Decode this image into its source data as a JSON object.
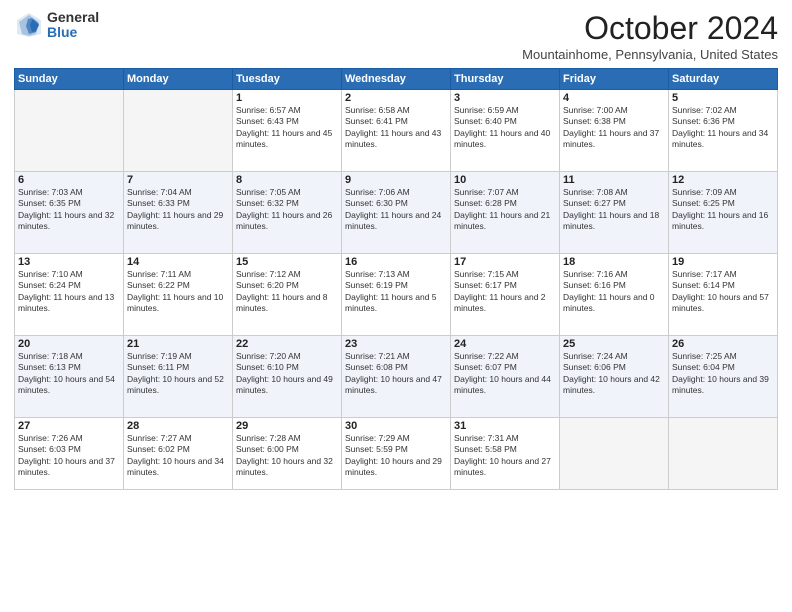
{
  "logo": {
    "general": "General",
    "blue": "Blue"
  },
  "header": {
    "month": "October 2024",
    "location": "Mountainhome, Pennsylvania, United States"
  },
  "days_of_week": [
    "Sunday",
    "Monday",
    "Tuesday",
    "Wednesday",
    "Thursday",
    "Friday",
    "Saturday"
  ],
  "weeks": [
    [
      {
        "day": "",
        "info": ""
      },
      {
        "day": "",
        "info": ""
      },
      {
        "day": "1",
        "info": "Sunrise: 6:57 AM\nSunset: 6:43 PM\nDaylight: 11 hours and 45 minutes."
      },
      {
        "day": "2",
        "info": "Sunrise: 6:58 AM\nSunset: 6:41 PM\nDaylight: 11 hours and 43 minutes."
      },
      {
        "day": "3",
        "info": "Sunrise: 6:59 AM\nSunset: 6:40 PM\nDaylight: 11 hours and 40 minutes."
      },
      {
        "day": "4",
        "info": "Sunrise: 7:00 AM\nSunset: 6:38 PM\nDaylight: 11 hours and 37 minutes."
      },
      {
        "day": "5",
        "info": "Sunrise: 7:02 AM\nSunset: 6:36 PM\nDaylight: 11 hours and 34 minutes."
      }
    ],
    [
      {
        "day": "6",
        "info": "Sunrise: 7:03 AM\nSunset: 6:35 PM\nDaylight: 11 hours and 32 minutes."
      },
      {
        "day": "7",
        "info": "Sunrise: 7:04 AM\nSunset: 6:33 PM\nDaylight: 11 hours and 29 minutes."
      },
      {
        "day": "8",
        "info": "Sunrise: 7:05 AM\nSunset: 6:32 PM\nDaylight: 11 hours and 26 minutes."
      },
      {
        "day": "9",
        "info": "Sunrise: 7:06 AM\nSunset: 6:30 PM\nDaylight: 11 hours and 24 minutes."
      },
      {
        "day": "10",
        "info": "Sunrise: 7:07 AM\nSunset: 6:28 PM\nDaylight: 11 hours and 21 minutes."
      },
      {
        "day": "11",
        "info": "Sunrise: 7:08 AM\nSunset: 6:27 PM\nDaylight: 11 hours and 18 minutes."
      },
      {
        "day": "12",
        "info": "Sunrise: 7:09 AM\nSunset: 6:25 PM\nDaylight: 11 hours and 16 minutes."
      }
    ],
    [
      {
        "day": "13",
        "info": "Sunrise: 7:10 AM\nSunset: 6:24 PM\nDaylight: 11 hours and 13 minutes."
      },
      {
        "day": "14",
        "info": "Sunrise: 7:11 AM\nSunset: 6:22 PM\nDaylight: 11 hours and 10 minutes."
      },
      {
        "day": "15",
        "info": "Sunrise: 7:12 AM\nSunset: 6:20 PM\nDaylight: 11 hours and 8 minutes."
      },
      {
        "day": "16",
        "info": "Sunrise: 7:13 AM\nSunset: 6:19 PM\nDaylight: 11 hours and 5 minutes."
      },
      {
        "day": "17",
        "info": "Sunrise: 7:15 AM\nSunset: 6:17 PM\nDaylight: 11 hours and 2 minutes."
      },
      {
        "day": "18",
        "info": "Sunrise: 7:16 AM\nSunset: 6:16 PM\nDaylight: 11 hours and 0 minutes."
      },
      {
        "day": "19",
        "info": "Sunrise: 7:17 AM\nSunset: 6:14 PM\nDaylight: 10 hours and 57 minutes."
      }
    ],
    [
      {
        "day": "20",
        "info": "Sunrise: 7:18 AM\nSunset: 6:13 PM\nDaylight: 10 hours and 54 minutes."
      },
      {
        "day": "21",
        "info": "Sunrise: 7:19 AM\nSunset: 6:11 PM\nDaylight: 10 hours and 52 minutes."
      },
      {
        "day": "22",
        "info": "Sunrise: 7:20 AM\nSunset: 6:10 PM\nDaylight: 10 hours and 49 minutes."
      },
      {
        "day": "23",
        "info": "Sunrise: 7:21 AM\nSunset: 6:08 PM\nDaylight: 10 hours and 47 minutes."
      },
      {
        "day": "24",
        "info": "Sunrise: 7:22 AM\nSunset: 6:07 PM\nDaylight: 10 hours and 44 minutes."
      },
      {
        "day": "25",
        "info": "Sunrise: 7:24 AM\nSunset: 6:06 PM\nDaylight: 10 hours and 42 minutes."
      },
      {
        "day": "26",
        "info": "Sunrise: 7:25 AM\nSunset: 6:04 PM\nDaylight: 10 hours and 39 minutes."
      }
    ],
    [
      {
        "day": "27",
        "info": "Sunrise: 7:26 AM\nSunset: 6:03 PM\nDaylight: 10 hours and 37 minutes."
      },
      {
        "day": "28",
        "info": "Sunrise: 7:27 AM\nSunset: 6:02 PM\nDaylight: 10 hours and 34 minutes."
      },
      {
        "day": "29",
        "info": "Sunrise: 7:28 AM\nSunset: 6:00 PM\nDaylight: 10 hours and 32 minutes."
      },
      {
        "day": "30",
        "info": "Sunrise: 7:29 AM\nSunset: 5:59 PM\nDaylight: 10 hours and 29 minutes."
      },
      {
        "day": "31",
        "info": "Sunrise: 7:31 AM\nSunset: 5:58 PM\nDaylight: 10 hours and 27 minutes."
      },
      {
        "day": "",
        "info": ""
      },
      {
        "day": "",
        "info": ""
      }
    ]
  ]
}
